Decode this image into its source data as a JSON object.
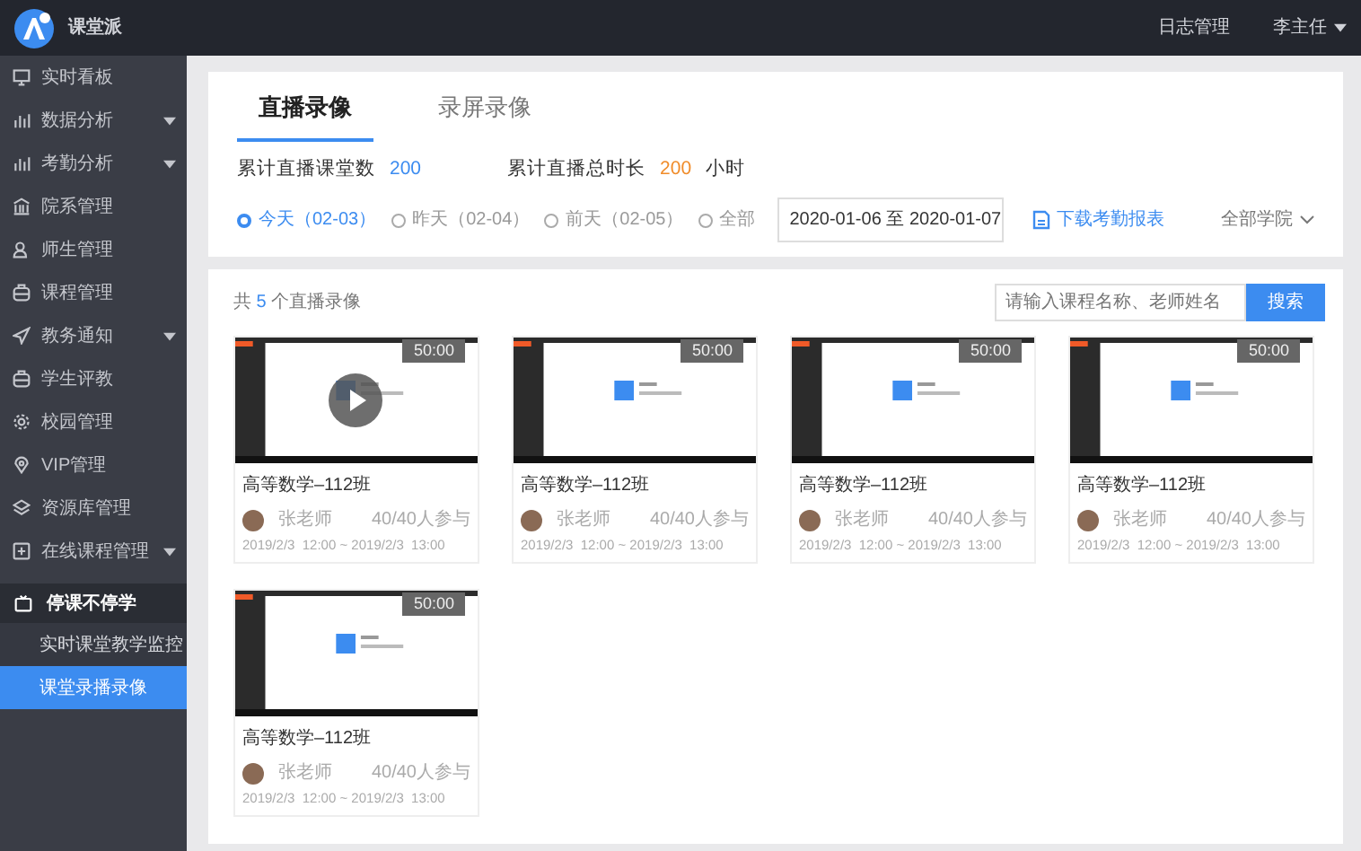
{
  "header": {
    "brand": "课堂派",
    "links": [
      "日志管理"
    ],
    "user": "李主任"
  },
  "sidebar": {
    "items": [
      {
        "label": "实时看板",
        "expandable": false
      },
      {
        "label": "数据分析",
        "expandable": true
      },
      {
        "label": "考勤分析",
        "expandable": true
      },
      {
        "label": "院系管理",
        "expandable": false
      },
      {
        "label": "师生管理",
        "expandable": false
      },
      {
        "label": "课程管理",
        "expandable": false
      },
      {
        "label": "教务通知",
        "expandable": true
      },
      {
        "label": "学生评教",
        "expandable": false
      },
      {
        "label": "校园管理",
        "expandable": false
      },
      {
        "label": "VIP管理",
        "expandable": false
      },
      {
        "label": "资源库管理",
        "expandable": false
      },
      {
        "label": "在线课程管理",
        "expandable": true
      }
    ],
    "group": {
      "label": "停课不停学",
      "expanded": true,
      "children": [
        {
          "label": "实时课堂教学监控",
          "selected": false
        },
        {
          "label": "课堂录播录像",
          "selected": true
        }
      ]
    }
  },
  "tabs": [
    {
      "label": "直播录像",
      "selected": true
    },
    {
      "label": "录屏录像",
      "selected": false
    }
  ],
  "stats": [
    {
      "label": "累计直播课堂数",
      "value": "200",
      "color": "#3c8cf0"
    },
    {
      "label": "累计直播总时长",
      "value": "200",
      "unit": "小时",
      "color": "#f08c2a"
    }
  ],
  "filters": [
    {
      "label": "今天（02-03）",
      "selected": true
    },
    {
      "label": "昨天（02-04）",
      "selected": false
    },
    {
      "label": "前天（02-05）",
      "selected": false
    },
    {
      "label": "全部",
      "selected": false
    }
  ],
  "date_range": "2020-01-06 至 2020-01-07",
  "download_link": "下载考勤报表",
  "college_dropdown": "全部学院",
  "result_count": {
    "prefix": "共",
    "count": "5",
    "suffix": "个直播录像"
  },
  "search": {
    "placeholder": "请输入课程名称、老师姓名",
    "button": "搜索"
  },
  "videos": [
    {
      "duration": "50:00",
      "title": "高等数学–112班",
      "teacher": "张老师",
      "attendance": "40/40人参与",
      "time": "2019/2/3  12:00 ~ 2019/2/3  13:00",
      "hovered": true
    },
    {
      "duration": "50:00",
      "title": "高等数学–112班",
      "teacher": "张老师",
      "attendance": "40/40人参与",
      "time": "2019/2/3  12:00 ~ 2019/2/3  13:00",
      "hovered": false
    },
    {
      "duration": "50:00",
      "title": "高等数学–112班",
      "teacher": "张老师",
      "attendance": "40/40人参与",
      "time": "2019/2/3  12:00 ~ 2019/2/3  13:00",
      "hovered": false
    },
    {
      "duration": "50:00",
      "title": "高等数学–112班",
      "teacher": "张老师",
      "attendance": "40/40人参与",
      "time": "2019/2/3  12:00 ~ 2019/2/3  13:00",
      "hovered": false
    },
    {
      "duration": "50:00",
      "title": "高等数学–112班",
      "teacher": "张老师",
      "attendance": "40/40人参与",
      "time": "2019/2/3  12:00 ~ 2019/2/3  13:00",
      "hovered": false
    }
  ]
}
